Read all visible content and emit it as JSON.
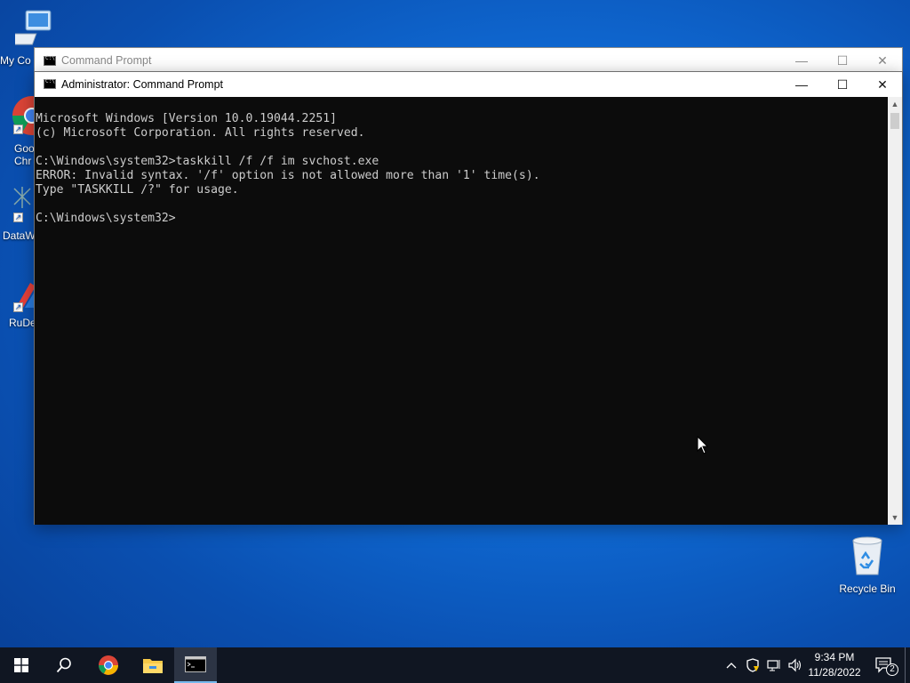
{
  "desktop": {
    "icons": [
      {
        "label": "My Co",
        "icon": "computer-icon"
      },
      {
        "label": "Goo Chr",
        "icon": "chrome-icon"
      },
      {
        "label": "DataW",
        "icon": "datawrapper-icon"
      },
      {
        "label": "RuDe",
        "icon": "rudesktop-icon"
      },
      {
        "label": "Recycle Bin",
        "icon": "recycle-bin-icon"
      }
    ]
  },
  "background_window": {
    "title": "Command Prompt",
    "controls": {
      "minimize": "—",
      "maximize": "☐",
      "close": "✕"
    }
  },
  "main_window": {
    "title": "Administrator: Command Prompt",
    "controls": {
      "minimize": "—",
      "maximize": "☐",
      "close": "✕"
    },
    "console_lines": [
      "Microsoft Windows [Version 10.0.19044.2251]",
      "(c) Microsoft Corporation. All rights reserved.",
      "",
      "C:\\Windows\\system32>taskkill /f /f im svchost.exe",
      "ERROR: Invalid syntax. '/f' option is not allowed more than '1' time(s).",
      "Type \"TASKKILL /?\" for usage.",
      "",
      "C:\\Windows\\system32>"
    ]
  },
  "taskbar": {
    "buttons": [
      "start-icon",
      "search-icon",
      "chrome-icon",
      "file-explorer-icon",
      "command-prompt-icon"
    ],
    "active": "command-prompt-icon",
    "tray": {
      "chevron": "^",
      "clock_time": "9:34 PM",
      "clock_date": "11/28/2022",
      "notification_count": "2"
    }
  },
  "colors": {
    "console_bg": "#0c0c0c",
    "console_fg": "#cccccc",
    "taskbar_bg": "#101622",
    "accent": "#76b9ed"
  }
}
